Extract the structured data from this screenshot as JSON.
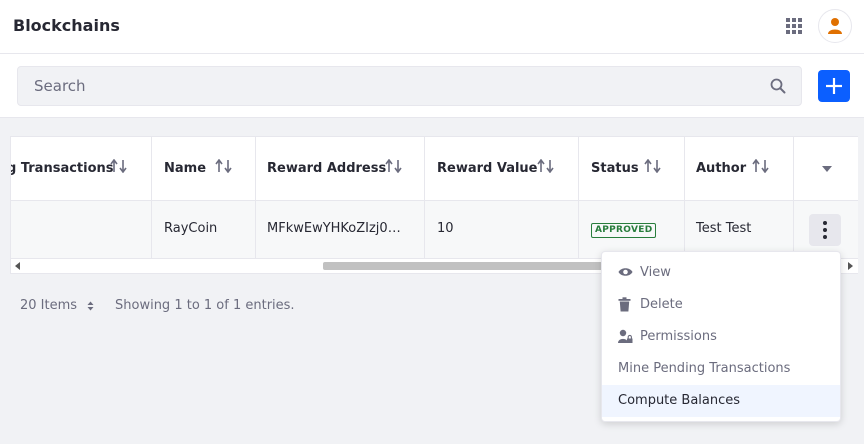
{
  "header": {
    "title": "Blockchains",
    "apps_icon": "grid-icon",
    "user_icon": "user-icon",
    "avatar_color": "#e07000"
  },
  "management_bar": {
    "search_placeholder": "Search",
    "search_value": "",
    "search_icon": "search-icon",
    "add_icon": "plus-icon",
    "add_color": "#0b5fff"
  },
  "table": {
    "columns": [
      {
        "label": "g Transactions"
      },
      {
        "label": "Name"
      },
      {
        "label": "Reward Address"
      },
      {
        "label": "Reward Value"
      },
      {
        "label": "Status"
      },
      {
        "label": "Author"
      }
    ],
    "rows": [
      {
        "pending_transactions": "",
        "name": "RayCoin",
        "reward_address": "MFkwEwYHKoZIzj0…",
        "reward_value": "10",
        "status": "APPROVED",
        "author": "Test Test"
      }
    ],
    "status_color": "#287d3c"
  },
  "pagination": {
    "items_per_page": "20 Items",
    "showing": "Showing 1 to 1 of 1 entries."
  },
  "actions_menu": {
    "items": [
      {
        "label": "View",
        "icon": "eye-icon"
      },
      {
        "label": "Delete",
        "icon": "trash-icon"
      },
      {
        "label": "Permissions",
        "icon": "permissions-icon"
      },
      {
        "label": "Mine Pending Transactions",
        "icon": ""
      },
      {
        "label": "Compute Balances",
        "icon": ""
      }
    ],
    "active_item": "Compute Balances"
  }
}
